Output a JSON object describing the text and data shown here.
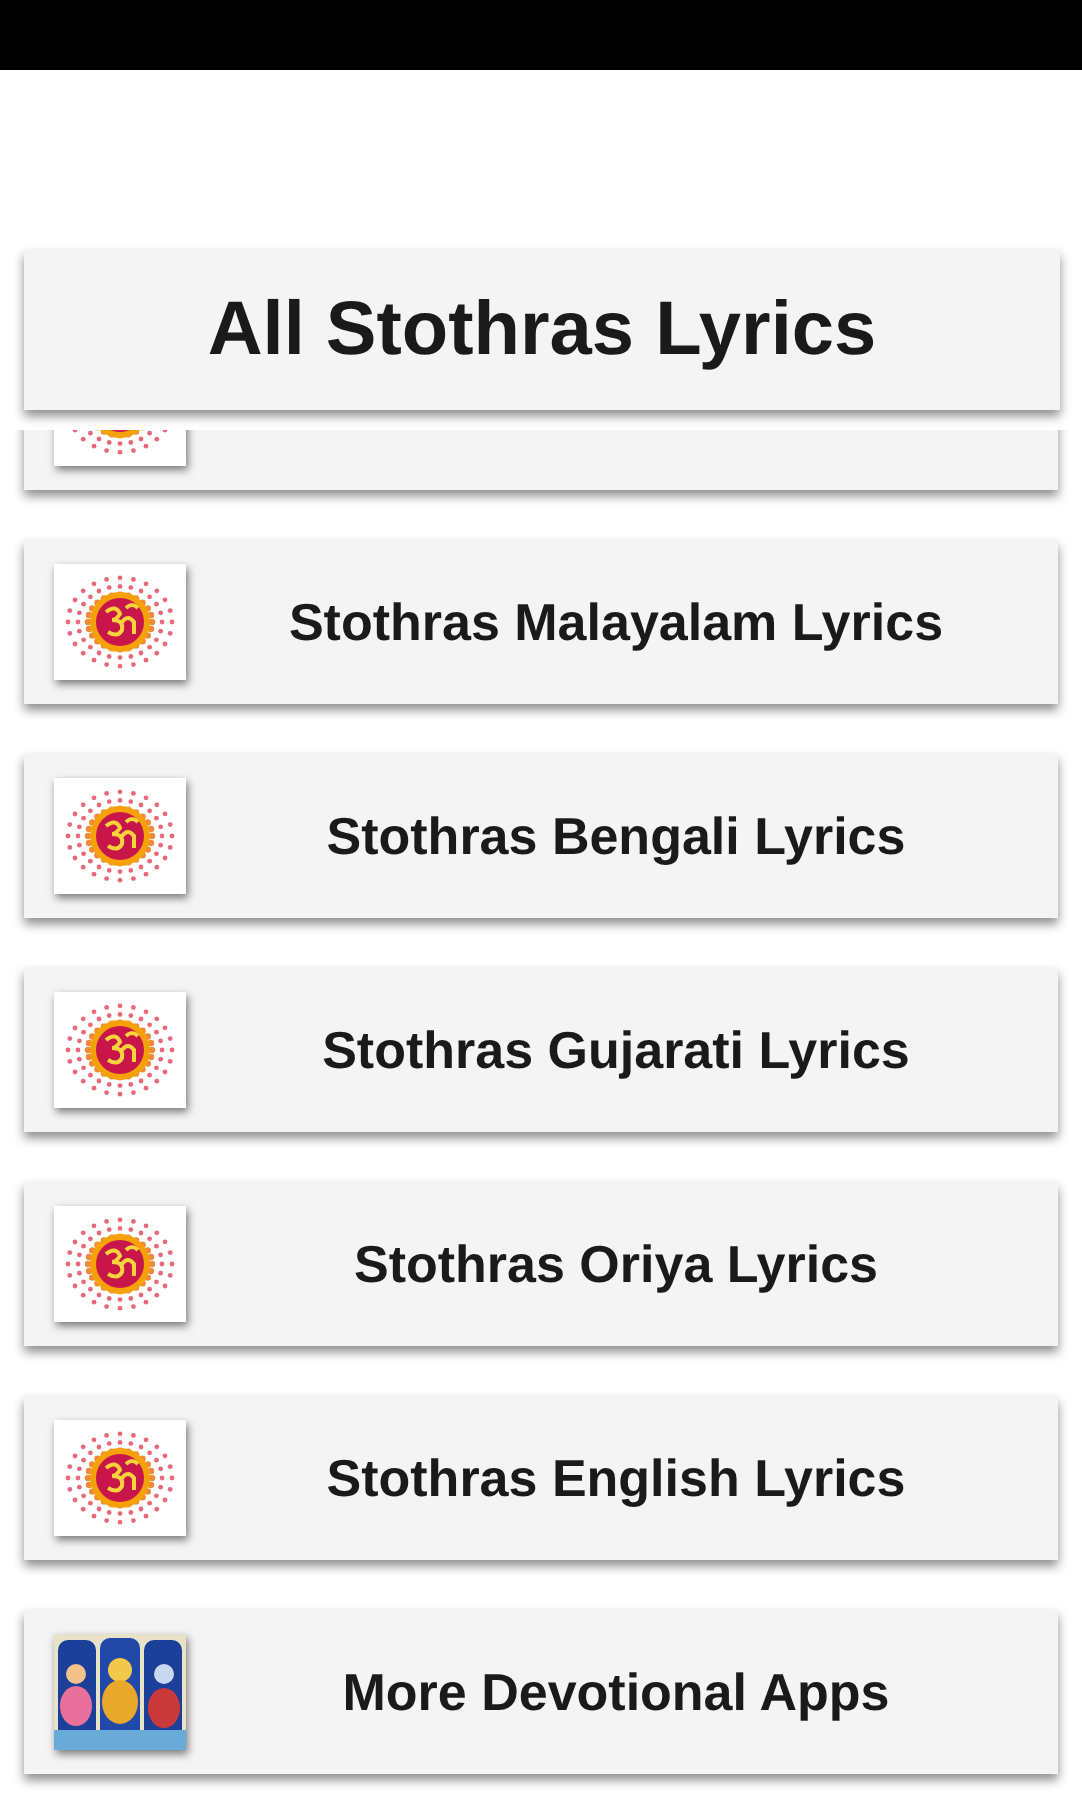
{
  "header": {
    "title": "All Stothras Lyrics"
  },
  "items": [
    {
      "kind": "stothra"
    },
    {
      "kind": "stothra",
      "label": "Stothras Malayalam Lyrics"
    },
    {
      "kind": "stothra",
      "label": "Stothras Bengali Lyrics"
    },
    {
      "kind": "stothra",
      "label": "Stothras Gujarati Lyrics"
    },
    {
      "kind": "stothra",
      "label": "Stothras Oriya Lyrics"
    },
    {
      "kind": "stothra",
      "label": "Stothras English Lyrics"
    },
    {
      "kind": "picture",
      "label": "More Devotional Apps"
    }
  ]
}
